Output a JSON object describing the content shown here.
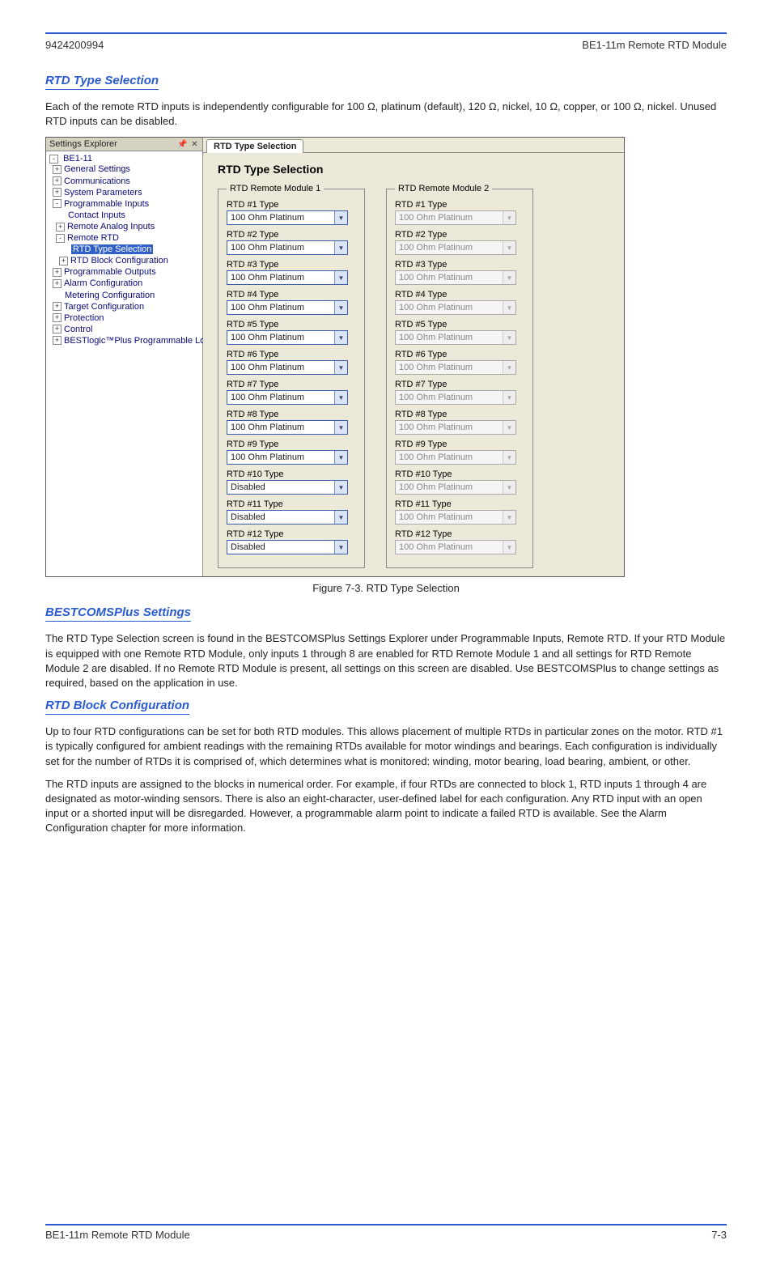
{
  "header": {
    "doc_code": "9424200994",
    "doc_title": "BE1-11m Remote RTD Module"
  },
  "page_label": "7-3",
  "sections": {
    "rtd_type_selection": {
      "heading": "RTD Type Selection",
      "para": "Each of the remote RTD inputs is independently configurable for 100 Ω, platinum (default), 120 Ω, nickel, 10 Ω, copper, or 100 Ω, nickel. Unused RTD inputs can be disabled."
    },
    "bestcoms": {
      "heading": "BESTCOMSPlus Settings",
      "para": "The RTD Type Selection screen is found in the BESTCOMSPlus Settings Explorer under Programmable Inputs, Remote RTD. If your RTD Module is equipped with one Remote RTD Module, only inputs 1 through 8 are enabled for RTD Remote Module 1 and all settings for RTD Remote Module 2 are disabled. If no Remote RTD Module is present, all settings on this screen are disabled. Use BESTCOMSPlus to change settings as required, based on the application in use."
    },
    "rtd_block": {
      "heading": "RTD Block Configuration",
      "para1": "Up to four RTD configurations can be set for both RTD modules. This allows placement of multiple RTDs in particular zones on the motor. RTD #1 is typically configured for ambient readings with the remaining RTDs available for motor windings and bearings. Each configuration is individually set for the number of RTDs it is comprised of, which determines what is monitored: winding, motor bearing, load bearing, ambient, or other.",
      "para2": "The RTD inputs are assigned to the blocks in numerical order. For example, if four RTDs are connected to block 1, RTD inputs 1 through 4 are designated as motor-winding sensors. There is also an eight-character, user-defined label for each configuration. Any RTD input with an open input or a shorted input will be disregarded. However, a programmable alarm point to indicate a failed RTD is available. See the Alarm Configuration chapter for more information."
    }
  },
  "figure_caption": "Figure 7-3. RTD Type Selection",
  "settings_explorer": {
    "title": "Settings Explorer",
    "pin_tip": "Pin",
    "close_tip": "Close",
    "tree": {
      "root": "BE1-11",
      "items": [
        {
          "label": "General Settings",
          "exp": "+"
        },
        {
          "label": "Communications",
          "exp": "+"
        },
        {
          "label": "System Parameters",
          "exp": "+"
        },
        {
          "label": "Programmable Inputs",
          "exp": "-",
          "children": [
            {
              "label": "Contact Inputs",
              "exp": ""
            },
            {
              "label": "Remote Analog Inputs",
              "exp": "+"
            },
            {
              "label": "Remote RTD",
              "exp": "-",
              "children": [
                {
                  "label": "RTD Type Selection",
                  "selected": true
                },
                {
                  "label": "RTD Block Configuration",
                  "exp": "+"
                }
              ]
            }
          ]
        },
        {
          "label": "Programmable Outputs",
          "exp": "+"
        },
        {
          "label": "Alarm Configuration",
          "exp": "+"
        },
        {
          "label": "Metering Configuration",
          "exp": ""
        },
        {
          "label": "Target Configuration",
          "exp": "+"
        },
        {
          "label": "Protection",
          "exp": "+"
        },
        {
          "label": "Control",
          "exp": "+"
        },
        {
          "label": "BESTlogic™Plus Programmable Logic",
          "exp": "+"
        }
      ]
    }
  },
  "rtd_form": {
    "tab": "RTD Type Selection",
    "heading": "RTD Type Selection",
    "modules": [
      {
        "legend": "RTD Remote Module 1",
        "enabled": true,
        "rows": [
          {
            "label": "RTD #1 Type",
            "value": "100 Ohm Platinum"
          },
          {
            "label": "RTD #2 Type",
            "value": "100 Ohm Platinum"
          },
          {
            "label": "RTD #3 Type",
            "value": "100 Ohm Platinum"
          },
          {
            "label": "RTD #4 Type",
            "value": "100 Ohm Platinum"
          },
          {
            "label": "RTD #5 Type",
            "value": "100 Ohm Platinum"
          },
          {
            "label": "RTD #6 Type",
            "value": "100 Ohm Platinum"
          },
          {
            "label": "RTD #7 Type",
            "value": "100 Ohm Platinum"
          },
          {
            "label": "RTD #8 Type",
            "value": "100 Ohm Platinum"
          },
          {
            "label": "RTD #9 Type",
            "value": "100 Ohm Platinum"
          },
          {
            "label": "RTD #10 Type",
            "value": "Disabled"
          },
          {
            "label": "RTD #11 Type",
            "value": "Disabled"
          },
          {
            "label": "RTD #12 Type",
            "value": "Disabled"
          }
        ]
      },
      {
        "legend": "RTD Remote Module 2",
        "enabled": false,
        "rows": [
          {
            "label": "RTD #1 Type",
            "value": "100 Ohm Platinum"
          },
          {
            "label": "RTD #2 Type",
            "value": "100 Ohm Platinum"
          },
          {
            "label": "RTD #3 Type",
            "value": "100 Ohm Platinum"
          },
          {
            "label": "RTD #4 Type",
            "value": "100 Ohm Platinum"
          },
          {
            "label": "RTD #5 Type",
            "value": "100 Ohm Platinum"
          },
          {
            "label": "RTD #6 Type",
            "value": "100 Ohm Platinum"
          },
          {
            "label": "RTD #7 Type",
            "value": "100 Ohm Platinum"
          },
          {
            "label": "RTD #8 Type",
            "value": "100 Ohm Platinum"
          },
          {
            "label": "RTD #9 Type",
            "value": "100 Ohm Platinum"
          },
          {
            "label": "RTD #10 Type",
            "value": "100 Ohm Platinum"
          },
          {
            "label": "RTD #11 Type",
            "value": "100 Ohm Platinum"
          },
          {
            "label": "RTD #12 Type",
            "value": "100 Ohm Platinum"
          }
        ]
      }
    ]
  }
}
